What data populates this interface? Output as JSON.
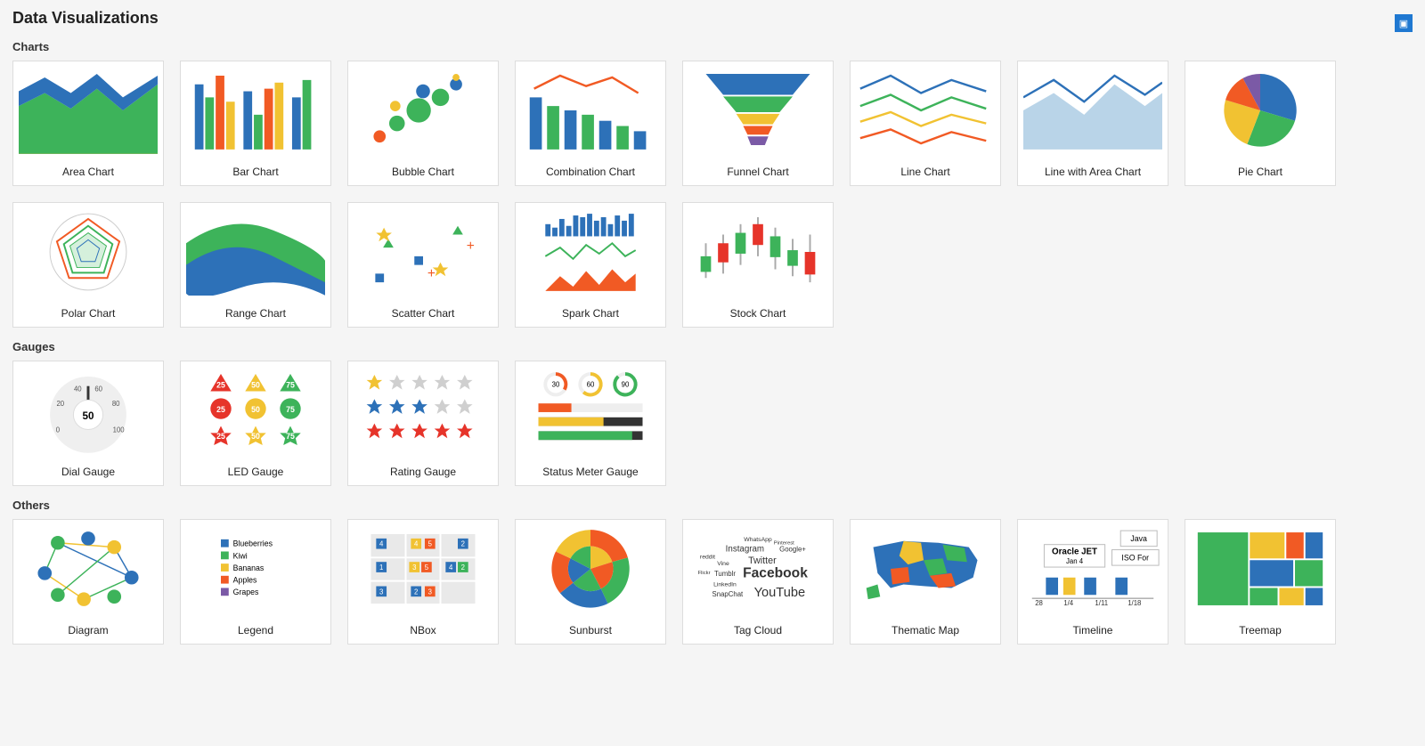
{
  "page_title": "Data Visualizations",
  "sections": {
    "charts": {
      "heading": "Charts",
      "items": [
        "Area Chart",
        "Bar Chart",
        "Bubble Chart",
        "Combination Chart",
        "Funnel Chart",
        "Line Chart",
        "Line with Area Chart",
        "Pie Chart",
        "Polar Chart",
        "Range Chart",
        "Scatter Chart",
        "Spark Chart",
        "Stock Chart"
      ]
    },
    "gauges": {
      "heading": "Gauges",
      "items": [
        "Dial Gauge",
        "LED Gauge",
        "Rating Gauge",
        "Status Meter Gauge"
      ],
      "led_values": [
        25,
        50,
        75,
        25,
        50,
        75,
        25,
        50,
        75
      ],
      "dial_value": 50,
      "dial_ticks": [
        0,
        20,
        40,
        60,
        80,
        100
      ],
      "status_values": [
        30,
        60,
        90
      ]
    },
    "others": {
      "heading": "Others",
      "items": [
        "Diagram",
        "Legend",
        "NBox",
        "Sunburst",
        "Tag Cloud",
        "Thematic Map",
        "Timeline",
        "Treemap"
      ],
      "legend_items": [
        "Blueberries",
        "Kiwi",
        "Bananas",
        "Apples",
        "Grapes"
      ],
      "tagcloud_words": [
        "WhatsApp",
        "Instagram",
        "Google+",
        "reddit",
        "Pinterest",
        "Vine",
        "Twitter",
        "Flickr",
        "Tumblr",
        "Facebook",
        "LinkedIn",
        "SnapChat",
        "YouTube"
      ],
      "timeline_labels": [
        "Java",
        "Oracle JET",
        "Jan 4",
        "ISO For",
        "28",
        "1/4",
        "1/11",
        "1/18"
      ],
      "nbox_values": [
        4,
        4,
        5,
        2,
        1,
        3,
        5,
        4,
        2,
        3,
        2,
        3
      ]
    }
  },
  "colors": {
    "blue": "#2d71b8",
    "green": "#3db35a",
    "yellow": "#f1c232",
    "orange": "#f15a24",
    "purple": "#7b5aa6",
    "red": "#e6342a",
    "grey": "#cfcfcf",
    "lightblue": "#b9d4e8"
  }
}
